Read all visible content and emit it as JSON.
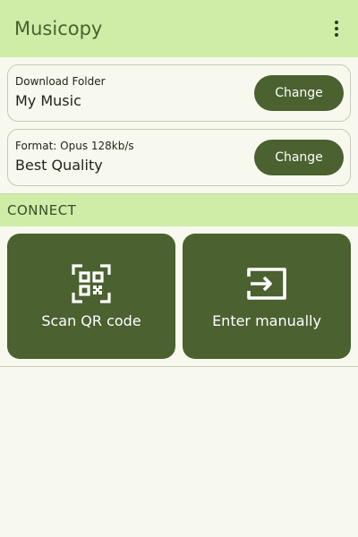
{
  "app": {
    "title": "Musicopy"
  },
  "download_folder": {
    "label": "Download Folder",
    "value": "My Music",
    "button_label": "Change"
  },
  "format": {
    "label": "Format: Opus 128kb/s",
    "value": "Best Quality",
    "button_label": "Change"
  },
  "connect": {
    "section_title": "CONNECT",
    "scan_label": "Scan QR code",
    "manual_label": "Enter manually"
  },
  "icons": {
    "menu": "more-vert-icon",
    "scan": "qr-code-scanner-icon",
    "manual": "input-icon"
  },
  "colors": {
    "app_bar": "#cfeda7",
    "accent": "#4b6130",
    "background": "#f8f9ee"
  }
}
